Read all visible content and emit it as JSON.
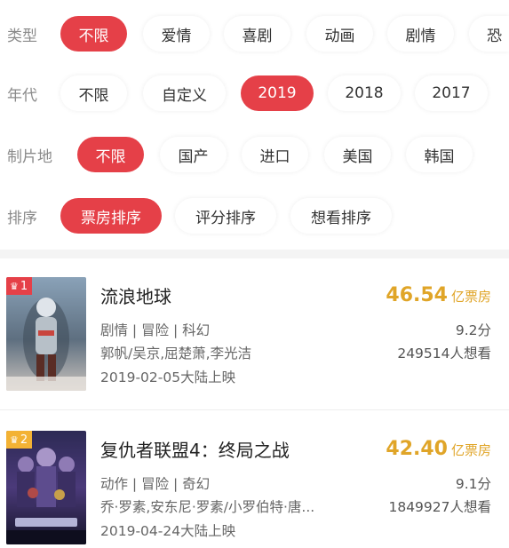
{
  "filters": {
    "type": {
      "label": "类型",
      "options": [
        {
          "label": "不限",
          "active": true
        },
        {
          "label": "爱情",
          "active": false
        },
        {
          "label": "喜剧",
          "active": false
        },
        {
          "label": "动画",
          "active": false
        },
        {
          "label": "剧情",
          "active": false
        },
        {
          "label": "恐",
          "active": false
        }
      ]
    },
    "year": {
      "label": "年代",
      "options": [
        {
          "label": "不限",
          "active": false
        },
        {
          "label": "自定义",
          "active": false
        },
        {
          "label": "2019",
          "active": true
        },
        {
          "label": "2018",
          "active": false
        },
        {
          "label": "2017",
          "active": false
        }
      ]
    },
    "region": {
      "label": "制片地",
      "options": [
        {
          "label": "不限",
          "active": true
        },
        {
          "label": "国产",
          "active": false
        },
        {
          "label": "进口",
          "active": false
        },
        {
          "label": "美国",
          "active": false
        },
        {
          "label": "韩国",
          "active": false
        }
      ]
    },
    "sort": {
      "label": "排序",
      "options": [
        {
          "label": "票房排序",
          "active": true
        },
        {
          "label": "评分排序",
          "active": false
        },
        {
          "label": "想看排序",
          "active": false
        }
      ]
    }
  },
  "colors": {
    "accent": "#e54048",
    "box_office": "#e0a528",
    "rank_gold": "#f3b234"
  },
  "movies": [
    {
      "rank": "1",
      "rank_icon": "crown-icon",
      "title": "流浪地球",
      "genres": "剧情 | 冒险 | 科幻",
      "cast": "郭帆/吴京,屈楚萧,李光洁",
      "release": "2019-02-05大陆上映",
      "box_office": "46.54",
      "box_unit": "亿票房",
      "score": "9.2分",
      "want": "249514人想看"
    },
    {
      "rank": "2",
      "rank_icon": "crown-icon",
      "title": "复仇者联盟4：终局之战",
      "genres": "动作 | 冒险 | 奇幻",
      "cast": "乔·罗素,安东尼·罗素/小罗伯特·唐...",
      "release": "2019-04-24大陆上映",
      "box_office": "42.40",
      "box_unit": "亿票房",
      "score": "9.1分",
      "want": "1849927人想看"
    }
  ]
}
